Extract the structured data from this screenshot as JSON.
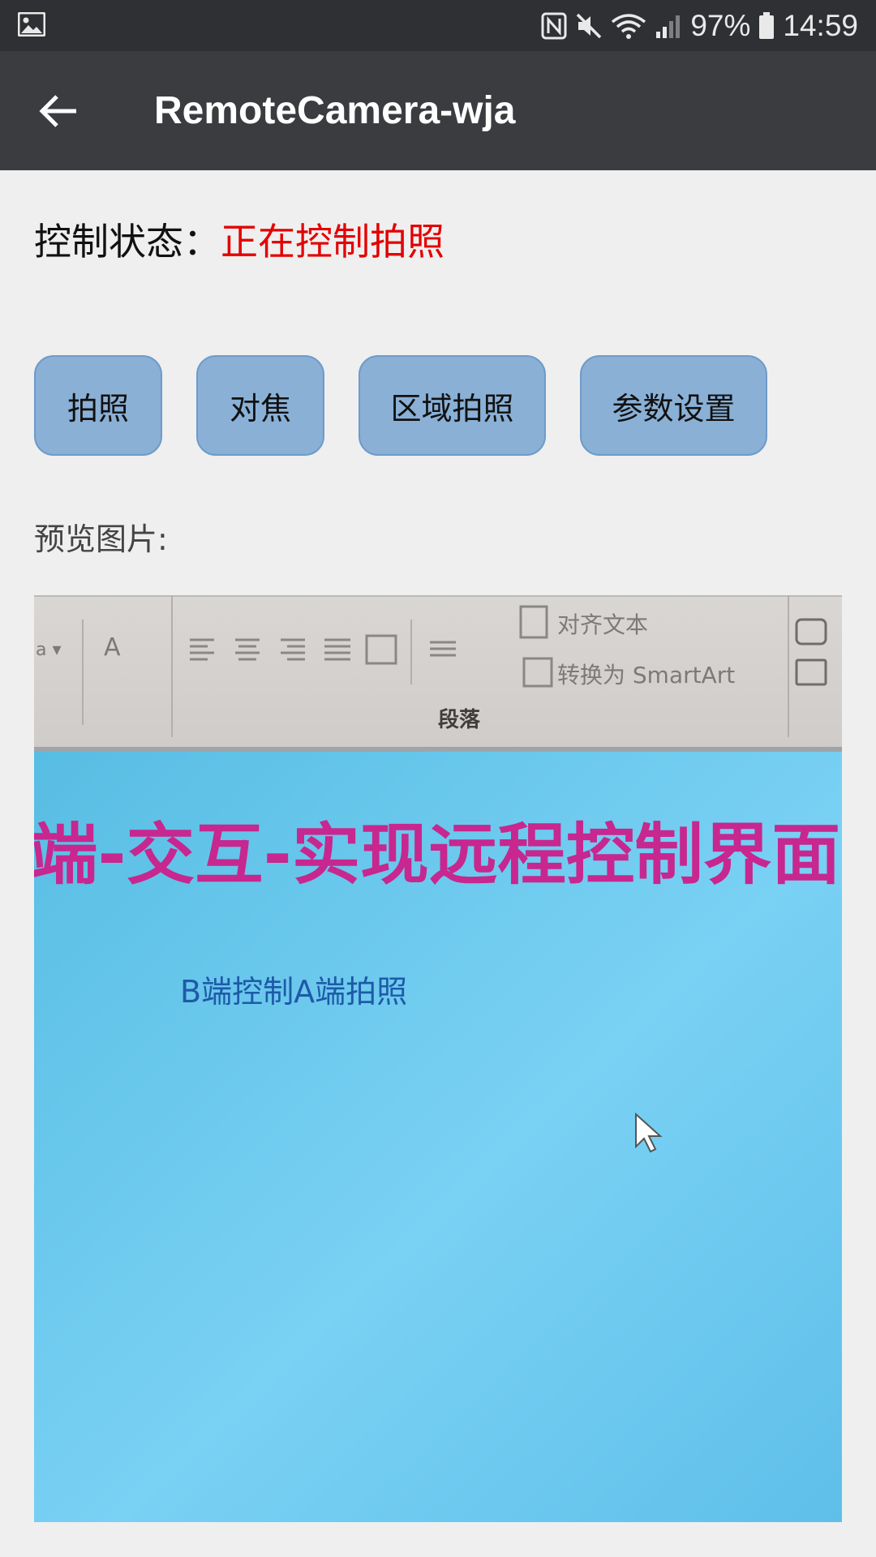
{
  "status_bar": {
    "battery": "97%",
    "time": "14:59",
    "icons": [
      "image-icon",
      "nfc-icon",
      "mute-icon",
      "wifi-icon",
      "signal-icon",
      "battery-icon"
    ]
  },
  "toolbar": {
    "title": "RemoteCamera-wja",
    "back_icon": "arrow-left-icon"
  },
  "control": {
    "label": "控制状态：",
    "value": "正在控制拍照",
    "value_color": "#e30000"
  },
  "buttons": {
    "shoot": "拍照",
    "focus": "对焦",
    "area_shoot": "区域拍照",
    "settings": "参数设置"
  },
  "preview": {
    "label": "预览图片:",
    "ribbon_align_text": "对齐文本",
    "ribbon_smartart": "转换为 SmartArt",
    "ribbon_paragraph": "段落",
    "ribbon_font_a": "A",
    "slide_title": "端-交互-实现远程控制界面",
    "slide_subtitle": "B端控制A端拍照"
  },
  "colors": {
    "status_bar_bg": "#2e3033",
    "toolbar_bg": "#3a3c40",
    "page_bg": "#efefef",
    "button_bg": "#8ab0d6",
    "slide_bg": "#6ccbef",
    "slide_title": "#c7278f",
    "slide_subtitle": "#1e5aa8"
  }
}
